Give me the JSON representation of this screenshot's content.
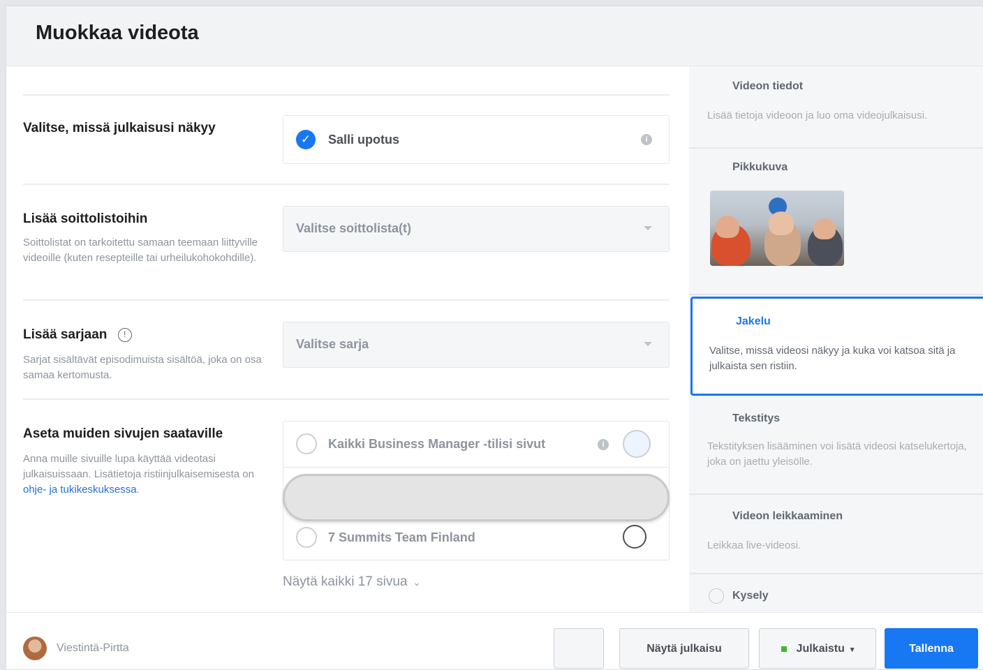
{
  "dialog": {
    "title": "Muokkaa videota"
  },
  "sections": {
    "visibility": {
      "label": "Valitse, missä julkaisusi näkyy",
      "checkbox_label": "Salli upotus"
    },
    "playlists": {
      "label": "Lisää soittolistoihin",
      "description": "Soittolistat on tarkoitettu samaan teemaan liittyville videoille (kuten resepteille tai urheilukohokohdille).",
      "select_placeholder": "Valitse soittolista(t)"
    },
    "series": {
      "label": "Lisää sarjaan",
      "description": "Sarjat sisältävät episodimuista sisältöä, joka on osa samaa kertomusta.",
      "select_placeholder": "Valitse sarja"
    },
    "crosspost": {
      "label": "Aseta muiden sivujen saataville",
      "description": "Anna muille sivuille lupa käyttää videotasi julkaisuissaan. Lisätietoja ristiinjulkaisemisesta on ",
      "link_text": "ohje- ja tukikeskuksessa",
      "description_end": ".",
      "pages": [
        {
          "label": "Kaikki Business Manager -tilisi sivut"
        },
        {
          "label": "7 Summits Team Finland"
        }
      ],
      "show_all": "Näytä kaikki 17 sivua"
    }
  },
  "sidebar": {
    "items": [
      {
        "title": "Videon tiedot",
        "description": "Lisää tietoja videoon ja luo oma videojulkaisusi."
      },
      {
        "title": "Pikkukuva"
      },
      {
        "title": "Jakelu",
        "description": "Valitse, missä videosi näkyy ja kuka voi katsoa sitä ja julkaista sen ristiin."
      },
      {
        "title": "Tekstitys",
        "description": "Tekstityksen lisääminen voi lisätä videosi katselukertoja, joka on jaettu yleisölle."
      },
      {
        "title": "Videon leikkaaminen",
        "description": "Leikkaa live-videosi."
      },
      {
        "title": "Kysely"
      }
    ]
  },
  "footer": {
    "user_name": "Viestintä-Pirtta",
    "preview_button": "Näytä julkaisu",
    "publish_button": "Julkaistu",
    "save_button": "Tallenna"
  },
  "colors": {
    "accent": "#1877f2",
    "status_green": "#42b72a"
  }
}
